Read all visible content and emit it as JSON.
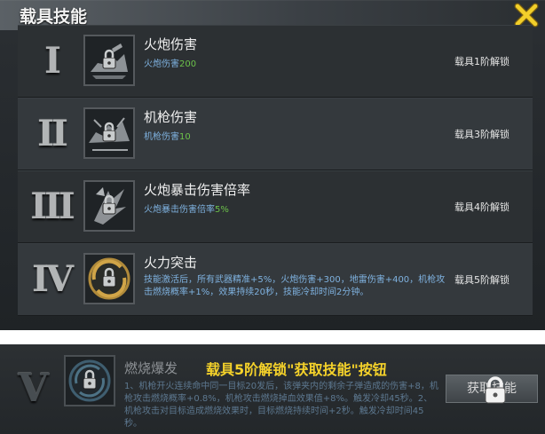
{
  "header": {
    "title": "载具技能"
  },
  "skills": [
    {
      "numeral": "I",
      "name": "火炮伤害",
      "desc_label": "火炮伤害",
      "desc_value": "200",
      "unlock": "载具1阶解锁"
    },
    {
      "numeral": "II",
      "name": "机枪伤害",
      "desc_label": "机枪伤害",
      "desc_value": "10",
      "unlock": "载具3阶解锁"
    },
    {
      "numeral": "III",
      "name": "火炮暴击伤害倍率",
      "desc_label": "火炮暴击伤害倍率",
      "desc_value": "5%",
      "unlock": "载具4阶解锁"
    },
    {
      "numeral": "IV",
      "name": "火力突击",
      "desc": "技能激活后，所有武器精准+5%，火炮伤害+300，地雷伤害+400，机枪攻击燃烧概率+1%，效果持续20秒，技能冷却时间2分钟。",
      "unlock": "载具5阶解锁"
    }
  ],
  "lower": {
    "numeral": "V",
    "name": "燃烧爆发",
    "tip": "载具5阶解锁\"获取技能\"按钮",
    "desc": "1、机枪开火连续命中同一目标20发后，该弹夹内的剩余子弹造成的伤害+8，机枪攻击燃烧概率+0.8%，机枪攻击燃烧掉血效果值+8%。触发冷却45秒。2、机枪攻击对目标造成燃烧效果时，目标燃烧持续时间+2秒。触发冷却时间45秒。",
    "button": "获取技能"
  },
  "colors": {
    "accent_value": "#6cc24a",
    "desc_blue": "#7fb2e0",
    "tip_yellow": "#f5d22a",
    "close_yellow": "#f2cf2a"
  }
}
